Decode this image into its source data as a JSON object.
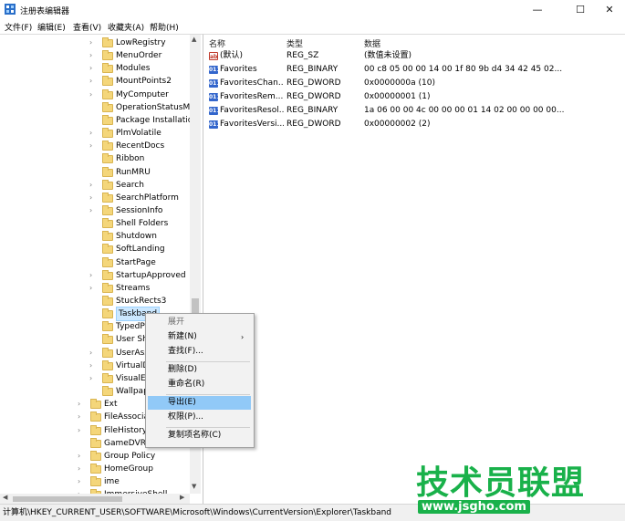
{
  "window": {
    "title": "注册表编辑器",
    "minimize": "—",
    "maximize": "☐",
    "close": "✕"
  },
  "menu": [
    "文件(F)",
    "编辑(E)",
    "查看(V)",
    "收藏夹(A)",
    "帮助(H)"
  ],
  "tree": {
    "items": [
      {
        "label": "LowRegistry",
        "expand": true
      },
      {
        "label": "MenuOrder",
        "expand": true
      },
      {
        "label": "Modules",
        "expand": true
      },
      {
        "label": "MountPoints2",
        "expand": true
      },
      {
        "label": "MyComputer",
        "expand": true
      },
      {
        "label": "OperationStatusMa",
        "expand": false
      },
      {
        "label": "Package Installatio",
        "expand": false
      },
      {
        "label": "PlmVolatile",
        "expand": true
      },
      {
        "label": "RecentDocs",
        "expand": true
      },
      {
        "label": "Ribbon",
        "expand": false
      },
      {
        "label": "RunMRU",
        "expand": false
      },
      {
        "label": "Search",
        "expand": true
      },
      {
        "label": "SearchPlatform",
        "expand": true
      },
      {
        "label": "SessionInfo",
        "expand": true
      },
      {
        "label": "Shell Folders",
        "expand": false
      },
      {
        "label": "Shutdown",
        "expand": false
      },
      {
        "label": "SoftLanding",
        "expand": false
      },
      {
        "label": "StartPage",
        "expand": false
      },
      {
        "label": "StartupApproved",
        "expand": true
      },
      {
        "label": "Streams",
        "expand": true
      },
      {
        "label": "StuckRects3",
        "expand": false
      },
      {
        "label": "Taskband",
        "expand": false,
        "selected": true
      },
      {
        "label": "TypedPa",
        "expand": false
      },
      {
        "label": "User Sh",
        "expand": false
      },
      {
        "label": "UserAss",
        "expand": true
      },
      {
        "label": "VirtualD",
        "expand": true
      },
      {
        "label": "VisualEf",
        "expand": true
      },
      {
        "label": "Wallpap",
        "expand": false
      }
    ],
    "parent_items": [
      {
        "label": "Ext",
        "expand": true
      },
      {
        "label": "FileAssociat",
        "expand": true
      },
      {
        "label": "FileHistory",
        "expand": true
      },
      {
        "label": "GameDVR",
        "expand": false
      },
      {
        "label": "Group Policy",
        "expand": true
      },
      {
        "label": "HomeGroup",
        "expand": true
      },
      {
        "label": "ime",
        "expand": true
      },
      {
        "label": "ImmersiveShell",
        "expand": true
      }
    ]
  },
  "values_pane": {
    "headers": [
      "名称",
      "类型",
      "数据"
    ],
    "rows": [
      {
        "icon": "string-value-icon",
        "name": "(默认)",
        "type": "REG_SZ",
        "data": "(数值未设置)"
      },
      {
        "icon": "binary-value-icon",
        "name": "Favorites",
        "type": "REG_BINARY",
        "data": "00 c8 05 00 00 14 00 1f 80 9b d4 34 42 45 02..."
      },
      {
        "icon": "binary-value-icon",
        "name": "FavoritesChan...",
        "type": "REG_DWORD",
        "data": "0x0000000a (10)"
      },
      {
        "icon": "binary-value-icon",
        "name": "FavoritesRem...",
        "type": "REG_DWORD",
        "data": "0x00000001 (1)"
      },
      {
        "icon": "binary-value-icon",
        "name": "FavoritesResol...",
        "type": "REG_BINARY",
        "data": "1a 06 00 00 4c 00 00 00 01 14 02 00 00 00 00..."
      },
      {
        "icon": "binary-value-icon",
        "name": "FavoritesVersi...",
        "type": "REG_DWORD",
        "data": "0x00000002 (2)"
      }
    ]
  },
  "context_menu": {
    "items": [
      {
        "label": "展开",
        "disabled": true
      },
      {
        "label": "新建(N)",
        "submenu": "›"
      },
      {
        "label": "查找(F)..."
      },
      {
        "label": "删除(D)"
      },
      {
        "label": "重命名(R)"
      },
      {
        "label": "导出(E)",
        "highlighted": true
      },
      {
        "label": "权限(P)..."
      },
      {
        "label": "复制项名称(C)"
      }
    ]
  },
  "status_bar": {
    "path": "计算机\\HKEY_CURRENT_USER\\SOFTWARE\\Microsoft\\Windows\\CurrentVersion\\Explorer\\Taskband"
  },
  "watermark": {
    "text": "技术员联盟",
    "url": "www.jsgho.com"
  }
}
